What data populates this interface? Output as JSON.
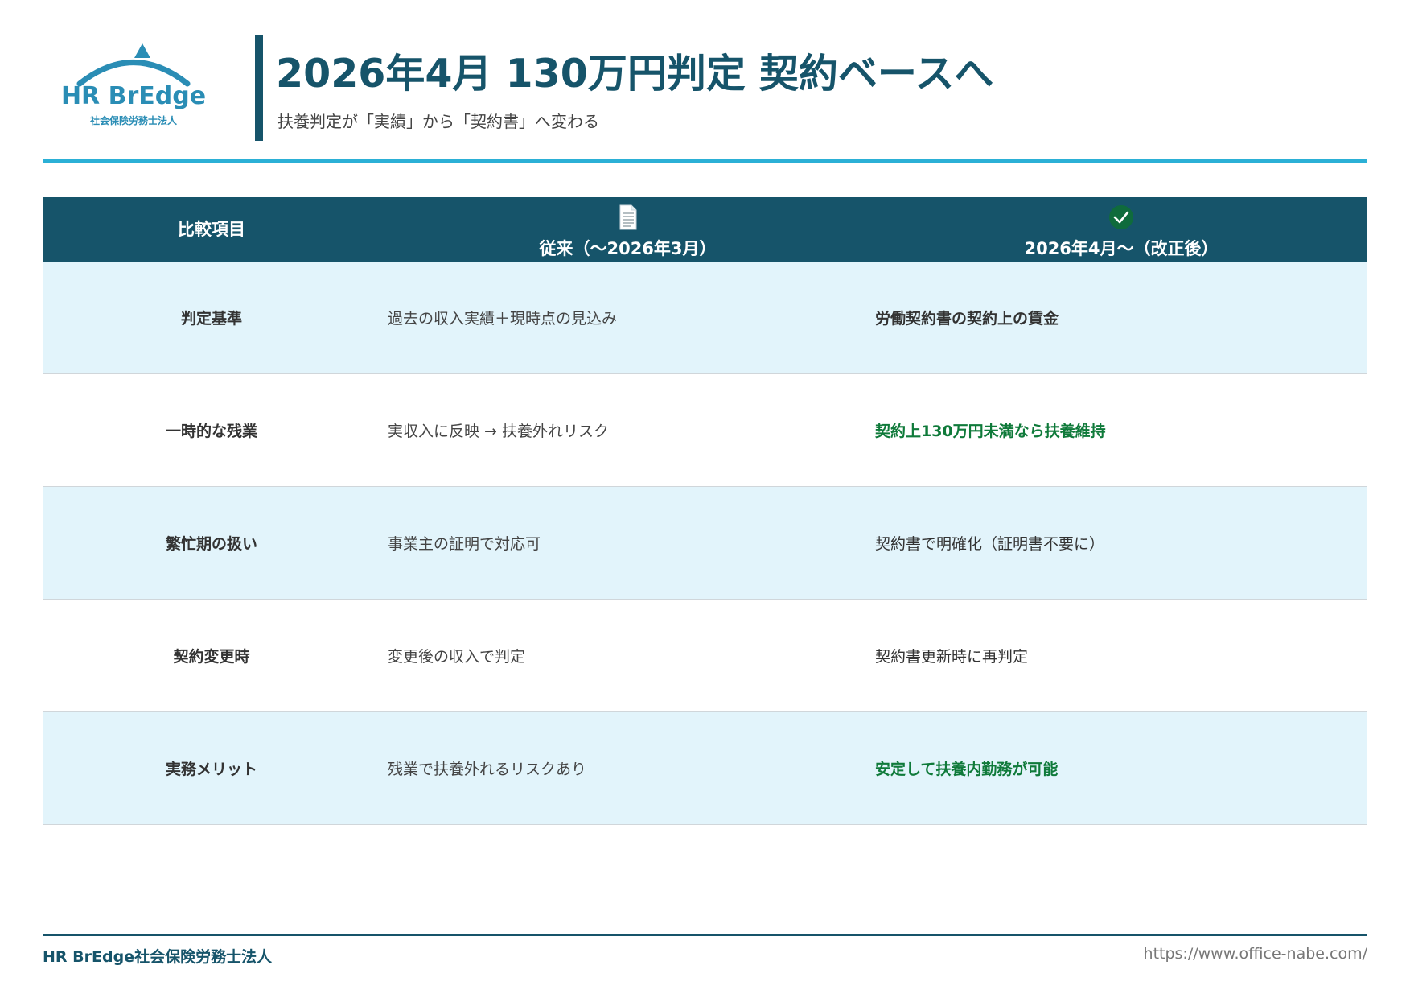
{
  "logo": {
    "name": "HR BrEdge",
    "sub": "社会保険労務士法人",
    "color": "#2a8db5"
  },
  "header": {
    "title": "2026年4月 130万円判定 契約ベースへ",
    "subtitle": "扶養判定が「実績」から「契約書」へ変わる"
  },
  "table": {
    "headers": {
      "item": "比較項目",
      "old": "従来（〜2026年3月）",
      "new": "2026年4月〜（改正後）",
      "old_icon": "document-icon",
      "new_icon": "check-circle-icon"
    },
    "rows": [
      {
        "item": "判定基準",
        "old": "過去の収入実績＋現時点の見込み",
        "new": "労働契約書の契約上の賃金"
      },
      {
        "item": "一時的な残業",
        "old": "実収入に反映 → 扶養外れリスク",
        "new": "契約上130万円未満なら扶養維持"
      },
      {
        "item": "繁忙期の扱い",
        "old": "事業主の証明で対応可",
        "new": "契約書で明確化（証明書不要に）"
      },
      {
        "item": "契約変更時",
        "old": "変更後の収入で判定",
        "new": "契約書更新時に再判定"
      },
      {
        "item": "実務メリット",
        "old": "残業で扶養外れるリスクあり",
        "new": "安定して扶養内勤務が可能"
      }
    ]
  },
  "colors": {
    "primary": "#16546a",
    "accent": "#2bb0d6",
    "highlight_green": "#0f7a3a",
    "row_tint": "#e2f4fb"
  },
  "footer": {
    "left": "HR BrEdge社会保険労務士法人",
    "right": "https://www.office-nabe.com/"
  }
}
